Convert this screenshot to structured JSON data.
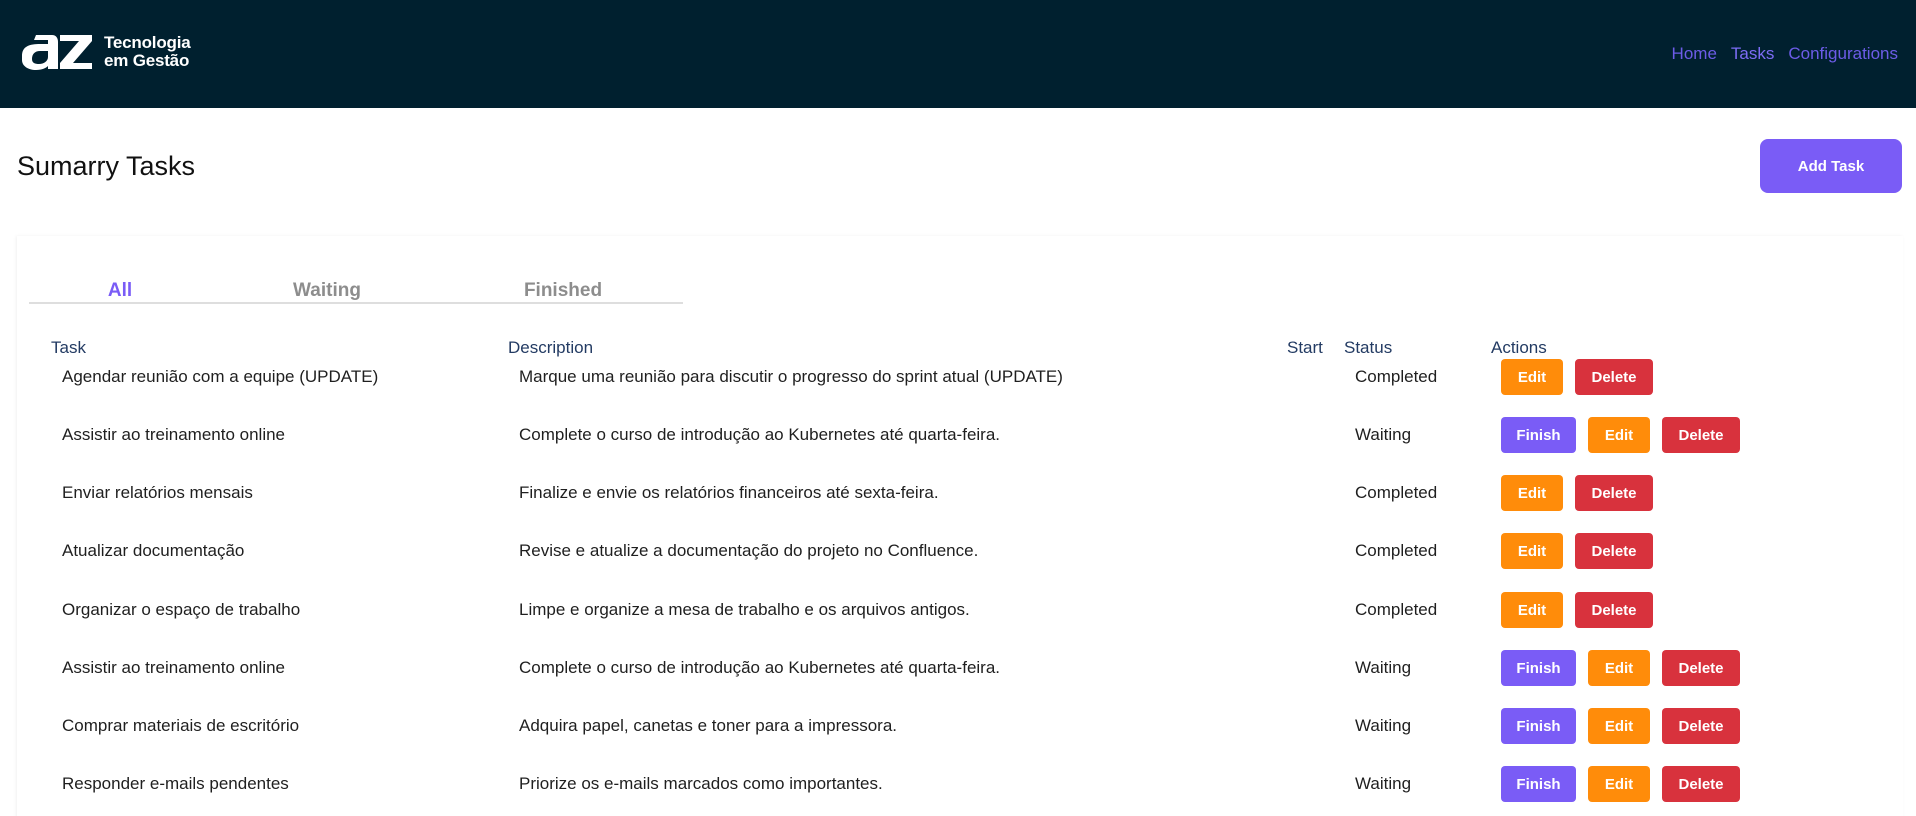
{
  "brand": {
    "name_line1": "Tecnologia",
    "name_line2": "em Gestão",
    "logo_icon": "az-logo-icon"
  },
  "nav": {
    "links": [
      "Home",
      "Tasks",
      "Configurations"
    ]
  },
  "page": {
    "title": "Sumarry Tasks",
    "add_button": "Add Task"
  },
  "tabs": [
    "All",
    "Waiting",
    "Finished"
  ],
  "table": {
    "headers": {
      "task": "Task",
      "description": "Description",
      "start": "Start",
      "status": "Status",
      "actions": "Actions"
    },
    "action_labels": {
      "finish": "Finish",
      "edit": "Edit",
      "delete": "Delete"
    },
    "rows": [
      {
        "task": "Agendar reunião com a equipe (UPDATE)",
        "description": "Marque uma reunião para discutir o progresso do sprint atual (UPDATE)",
        "start": "",
        "status": "Completed"
      },
      {
        "task": "Assistir ao treinamento online",
        "description": "Complete o curso de introdução ao Kubernetes até quarta-feira.",
        "start": "",
        "status": "Waiting"
      },
      {
        "task": "Enviar relatórios mensais",
        "description": "Finalize e envie os relatórios financeiros até sexta-feira.",
        "start": "",
        "status": "Completed"
      },
      {
        "task": "Atualizar documentação",
        "description": "Revise e atualize a documentação do projeto no Confluence.",
        "start": "",
        "status": "Completed"
      },
      {
        "task": "Organizar o espaço de trabalho",
        "description": "Limpe e organize a mesa de trabalho e os arquivos antigos.",
        "start": "",
        "status": "Completed"
      },
      {
        "task": "Assistir ao treinamento online",
        "description": "Complete o curso de introdução ao Kubernetes até quarta-feira.",
        "start": "",
        "status": "Waiting"
      },
      {
        "task": "Comprar materiais de escritório",
        "description": "Adquira papel, canetas e toner para a impressora.",
        "start": "",
        "status": "Waiting"
      },
      {
        "task": "Responder e-mails pendentes",
        "description": "Priorize os e-mails marcados como importantes.",
        "start": "",
        "status": "Waiting"
      }
    ]
  },
  "colors": {
    "navbar": "#00202f",
    "accent": "#7a5cf6",
    "edit": "#ff8c0a",
    "delete": "#d8323d"
  }
}
